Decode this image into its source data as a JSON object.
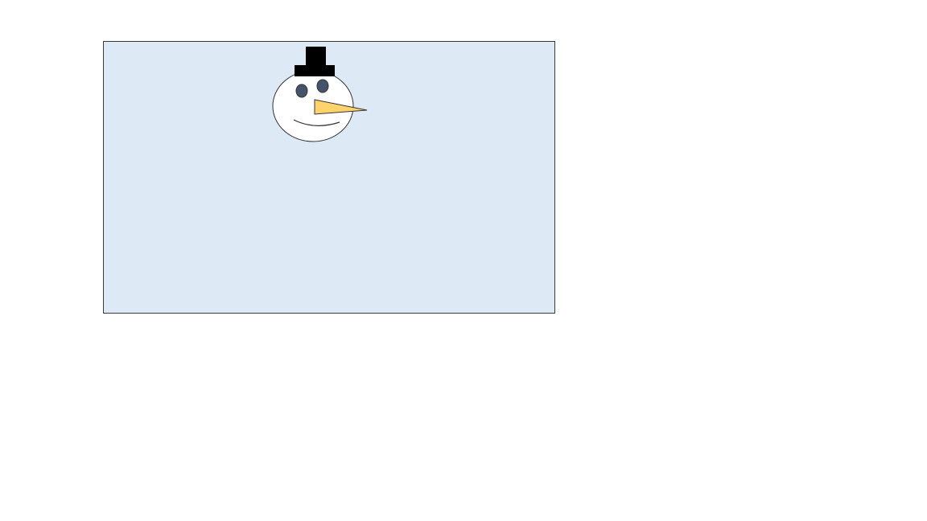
{
  "scene": {
    "elements": [
      "top-hat",
      "snowman-head",
      "left-eye",
      "right-eye",
      "carrot-nose",
      "smile"
    ]
  },
  "colors": {
    "page_background": "#ffffff",
    "canvas_background": "#dde9f5",
    "canvas_border": "#3a3a3a",
    "head_fill": "#ffffff",
    "outline": "#333333",
    "hat": "#000000",
    "eyes": "#44546a",
    "nose": "#ffd36b"
  }
}
